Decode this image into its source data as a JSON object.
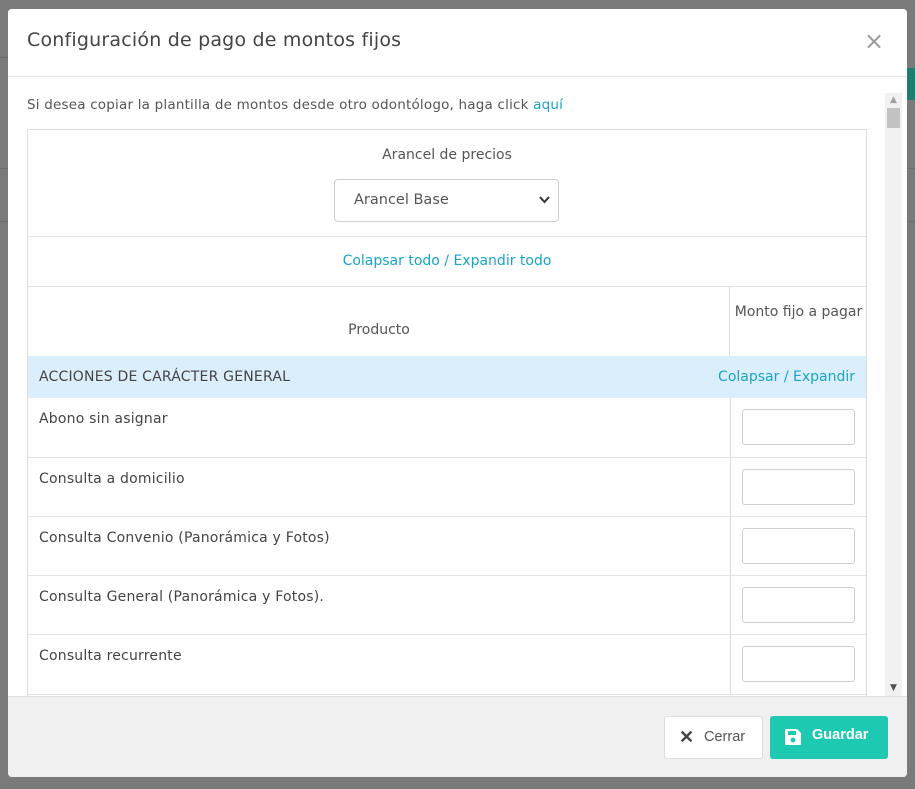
{
  "modal": {
    "title": "Configuración de pago de montos fijos",
    "close_icon": "close-icon"
  },
  "intro": {
    "text": "Si desea copiar la plantilla de montos desde otro odontólogo, haga click ",
    "link": "aquí"
  },
  "tariff": {
    "label": "Arancel de precios",
    "selected": "Arancel Base"
  },
  "collapse_all": "Colapsar todo / Expandir todo",
  "table": {
    "col_product": "Producto",
    "col_amount": "Monto fijo a pagar"
  },
  "group": {
    "title": "ACCIONES DE CARÁCTER GENERAL",
    "toggle": "Colapsar / Expandir"
  },
  "items": [
    {
      "name": "Abono sin asignar",
      "amount": ""
    },
    {
      "name": "Consulta a domicilio",
      "amount": ""
    },
    {
      "name": "Consulta Convenio (Panorámica y Fotos)",
      "amount": ""
    },
    {
      "name": "Consulta General (Panorámica y Fotos).",
      "amount": ""
    },
    {
      "name": "Consulta recurrente",
      "amount": ""
    }
  ],
  "footer": {
    "close_label": "Cerrar",
    "save_label": "Guardar"
  },
  "colors": {
    "accent": "#1aa3c7",
    "save_button": "#1ec9b1",
    "group_row": "#dbeefb"
  }
}
